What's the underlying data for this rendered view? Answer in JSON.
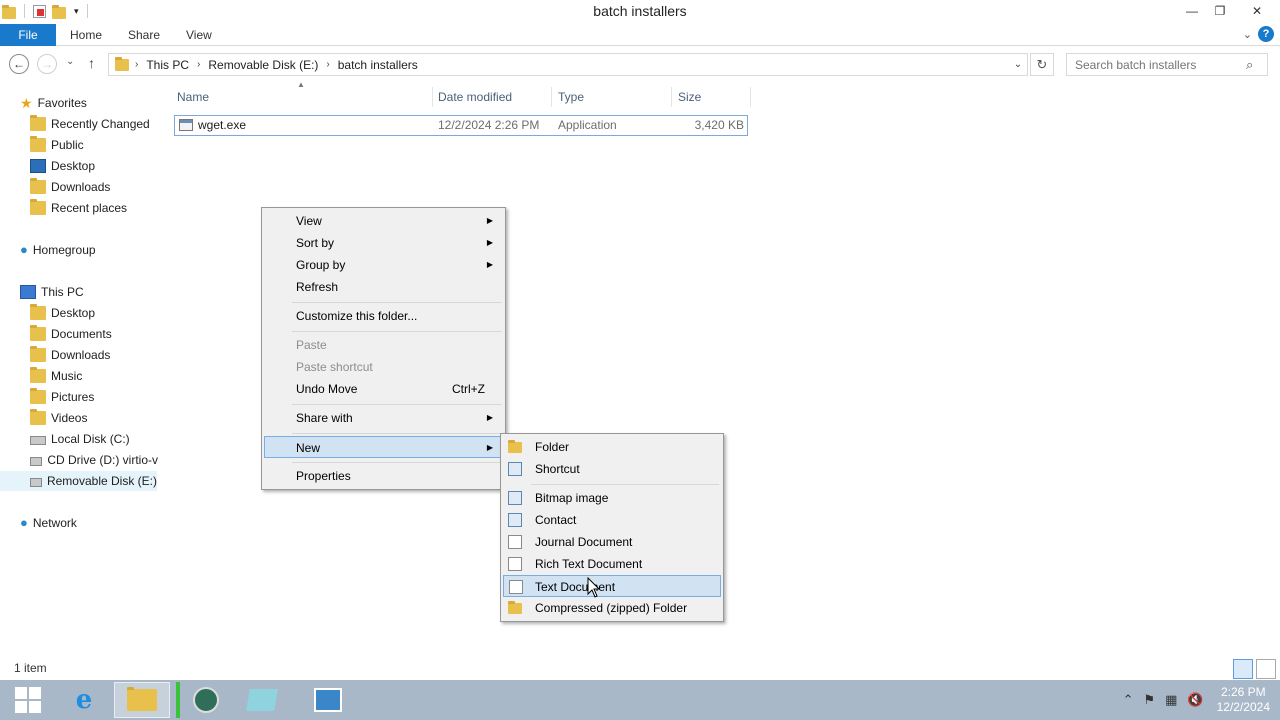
{
  "window": {
    "title": "batch installers",
    "buttons": {
      "minimize": "—",
      "maximize": "❐",
      "close": "✕"
    }
  },
  "ribbon": {
    "tabs": [
      "File",
      "Home",
      "Share",
      "View"
    ],
    "expand": "⌄",
    "help": "?"
  },
  "address": {
    "back": "←",
    "forward": "→",
    "recent": "⌄",
    "up": "↑",
    "path": [
      "This PC",
      "Removable Disk (E:)",
      "batch installers"
    ],
    "separator": "›",
    "dropdown": "⌄",
    "refresh": "↻",
    "search_placeholder": "Search batch installers",
    "search_icon": "⌕"
  },
  "nav": {
    "favorites_label": "Favorites",
    "favorites": [
      "Recently Changed",
      "Public",
      "Desktop",
      "Downloads",
      "Recent places"
    ],
    "homegroup": "Homegroup",
    "thispc_label": "This PC",
    "thispc": [
      "Desktop",
      "Documents",
      "Downloads",
      "Music",
      "Pictures",
      "Videos",
      "Local Disk (C:)",
      "CD Drive (D:) virtio-v",
      "Removable Disk (E:)"
    ],
    "network": "Network"
  },
  "columns": [
    "Name",
    "Date modified",
    "Type",
    "Size"
  ],
  "files": [
    {
      "name": "wget.exe",
      "date": "12/2/2024 2:26 PM",
      "type": "Application",
      "size": "3,420 KB"
    }
  ],
  "context_menu": {
    "items": [
      {
        "label": "View",
        "submenu": true
      },
      {
        "label": "Sort by",
        "submenu": true
      },
      {
        "label": "Group by",
        "submenu": true
      },
      {
        "label": "Refresh"
      },
      {
        "label": "Customize this folder..."
      },
      {
        "label": "Paste",
        "disabled": true
      },
      {
        "label": "Paste shortcut",
        "disabled": true
      },
      {
        "label": "Undo Move",
        "shortcut": "Ctrl+Z"
      },
      {
        "label": "Share with",
        "submenu": true
      },
      {
        "label": "New",
        "submenu": true,
        "highlighted": true
      },
      {
        "label": "Properties"
      }
    ],
    "arrow": "▶"
  },
  "new_submenu": {
    "items": [
      "Folder",
      "Shortcut",
      "Bitmap image",
      "Contact",
      "Journal Document",
      "Rich Text Document",
      "Text Document",
      "Compressed (zipped) Folder"
    ],
    "highlighted": "Text Document"
  },
  "status": {
    "items": "1 item"
  },
  "taskbar": {
    "time": "2:26 PM",
    "date": "12/2/2024",
    "tray": {
      "chevron": "⌃",
      "flag": "⚑",
      "network": "▦",
      "volume": "🔇"
    }
  }
}
